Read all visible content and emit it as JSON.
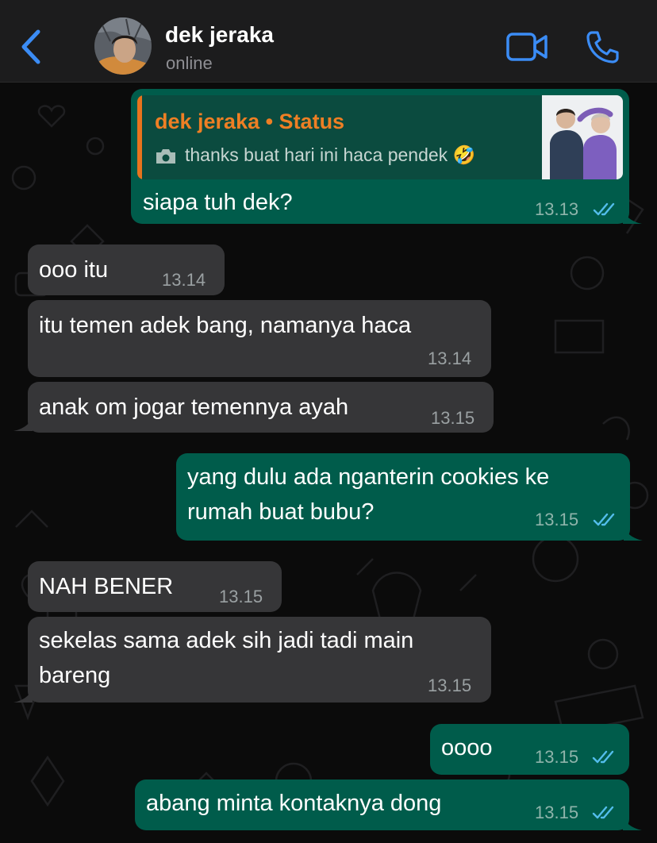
{
  "header": {
    "contact_name": "dek jeraka",
    "contact_status": "online"
  },
  "colors": {
    "accent": "#3b8cf5",
    "incoming_bubble": "#363638",
    "outgoing_bubble": "#005c4b",
    "quote_name": "#ee7f24"
  },
  "icons": [
    "back-chevron-icon",
    "video-call-icon",
    "phone-icon",
    "camera-icon",
    "double-check-icon"
  ],
  "quote": {
    "title": "dek jeraka • Status",
    "text": "thanks buat hari ini haca pendek 🤣"
  },
  "messages": [
    {
      "dir": "out",
      "lines": [
        "siapa tuh dek?"
      ],
      "time": "13.13",
      "read": true
    },
    {
      "dir": "in",
      "lines": [
        "ooo itu"
      ],
      "time": "13.14"
    },
    {
      "dir": "in",
      "lines": [
        "itu temen adek bang, namanya haca"
      ],
      "time": "13.14"
    },
    {
      "dir": "in",
      "lines": [
        "anak om jogar temennya ayah"
      ],
      "time": "13.15"
    },
    {
      "dir": "out",
      "lines": [
        "yang dulu ada nganterin cookies ke",
        "rumah buat bubu?"
      ],
      "time": "13.15",
      "read": true
    },
    {
      "dir": "in",
      "lines": [
        "NAH BENER"
      ],
      "time": "13.15"
    },
    {
      "dir": "in",
      "lines": [
        "sekelas sama adek sih jadi tadi main",
        "bareng"
      ],
      "time": "13.15"
    },
    {
      "dir": "out",
      "lines": [
        "oooo"
      ],
      "time": "13.15",
      "read": true
    },
    {
      "dir": "out",
      "lines": [
        "abang minta kontaknya dong"
      ],
      "time": "13.15",
      "read": true
    }
  ]
}
